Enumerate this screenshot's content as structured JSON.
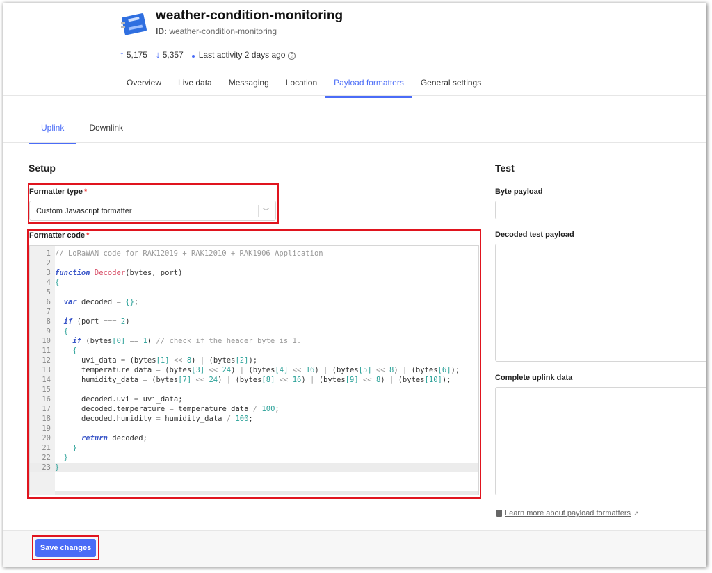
{
  "header": {
    "title": "weather-condition-monitoring",
    "id_label": "ID:",
    "id_value": "weather-condition-monitoring",
    "uplink_count": "5,175",
    "downlink_count": "5,357",
    "last_activity": "Last activity 2 days ago",
    "icon": "device-icon"
  },
  "tabs": [
    {
      "label": "Overview"
    },
    {
      "label": "Live data"
    },
    {
      "label": "Messaging"
    },
    {
      "label": "Location"
    },
    {
      "label": "Payload formatters",
      "active": true
    },
    {
      "label": "General settings"
    }
  ],
  "subtabs": [
    {
      "label": "Uplink",
      "active": true
    },
    {
      "label": "Downlink"
    }
  ],
  "setup": {
    "title": "Setup",
    "formatter_type_label": "Formatter type",
    "formatter_type_value": "Custom Javascript formatter",
    "formatter_code_label": "Formatter code",
    "required_mark": "*",
    "code_lines": [
      "// LoRaWAN code for RAK12019 + RAK12010 + RAK1906 Application",
      "",
      "function Decoder(bytes, port)",
      "{",
      "",
      "  var decoded = {};",
      "",
      "  if (port === 2)",
      "  {",
      "    if (bytes[0] == 1) // check if the header byte is 1.",
      "    {",
      "      uvi_data = (bytes[1] << 8) | (bytes[2]);",
      "      temperature_data = (bytes[3] << 24) | (bytes[4] << 16) | (bytes[5] << 8) | (bytes[6]);",
      "      humidity_data = (bytes[7] << 24) | (bytes[8] << 16) | (bytes[9] << 8) | (bytes[10]);",
      "",
      "      decoded.uvi = uvi_data;",
      "      decoded.temperature = temperature_data / 100;",
      "      decoded.humidity = humidity_data / 100;",
      "",
      "      return decoded;",
      "    }",
      "  }",
      "}"
    ]
  },
  "test": {
    "title": "Test",
    "byte_payload_label": "Byte payload",
    "byte_payload_value": "",
    "decoded_label": "Decoded test payload",
    "complete_label": "Complete uplink data",
    "learn_more": "Learn more about payload formatters"
  },
  "footer": {
    "save_label": "Save changes"
  },
  "colors": {
    "accent": "#4a6cf7",
    "highlight_box": "#e0141e"
  }
}
